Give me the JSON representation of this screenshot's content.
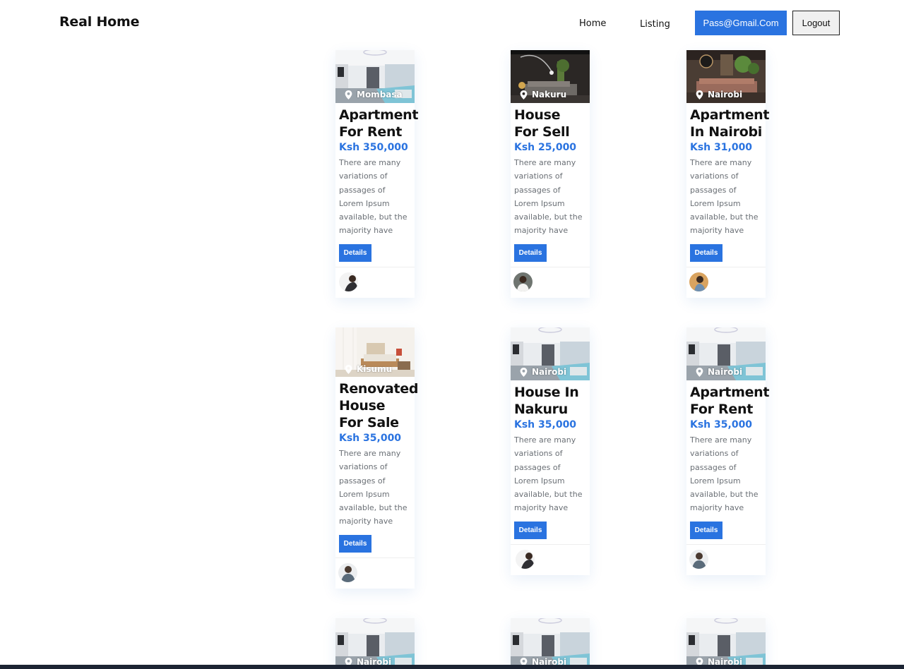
{
  "navbar": {
    "brand": "Real Home",
    "links": [
      "Home",
      "Listing"
    ],
    "user_email": "Pass@Gmail.Com",
    "logout_label": "Logout"
  },
  "listings": [
    {
      "location": "Mombasa",
      "title": "Apartment For Rent",
      "price": "Ksh 350,000",
      "description": "There are many variations of passages of Lorem Ipsum available, but the majority have suffered alter",
      "details_label": "Details"
    },
    {
      "location": "Nakuru",
      "title": "House For Sell",
      "price": "Ksh 25,000",
      "description": "There are many variations of passages of Lorem Ipsum available, but the majority have suffered alter",
      "details_label": "Details"
    },
    {
      "location": "Nairobi",
      "title": "Apartment In Nairobi",
      "price": "Ksh 31,000",
      "description": "There are many variations of passages of Lorem Ipsum available, but the majority have suffered alter",
      "details_label": "Details"
    },
    {
      "location": "Kisumu",
      "title": "Renovated House For Sale",
      "price": "Ksh 35,000",
      "description": "There are many variations of passages of Lorem Ipsum available, but the majority have suffered alter",
      "details_label": "Details"
    },
    {
      "location": "Nairobi",
      "title": "House In Nakuru",
      "price": "Ksh 35,000",
      "description": "There are many variations of passages of Lorem Ipsum available, but the majority have suffered alter",
      "details_label": "Details"
    },
    {
      "location": "Nairobi",
      "title": "Apartment For Rent",
      "price": "Ksh 35,000",
      "description": "There are many variations of passages of Lorem Ipsum available, but the majority have suffered alter",
      "details_label": "Details"
    },
    {
      "location": "Nairobi"
    },
    {
      "location": "Nairobi"
    },
    {
      "location": "Nairobi"
    }
  ],
  "colors": {
    "accent": "#2a73e0",
    "price": "#2a73e0",
    "text": "#111111",
    "muted": "#6a6f75"
  }
}
